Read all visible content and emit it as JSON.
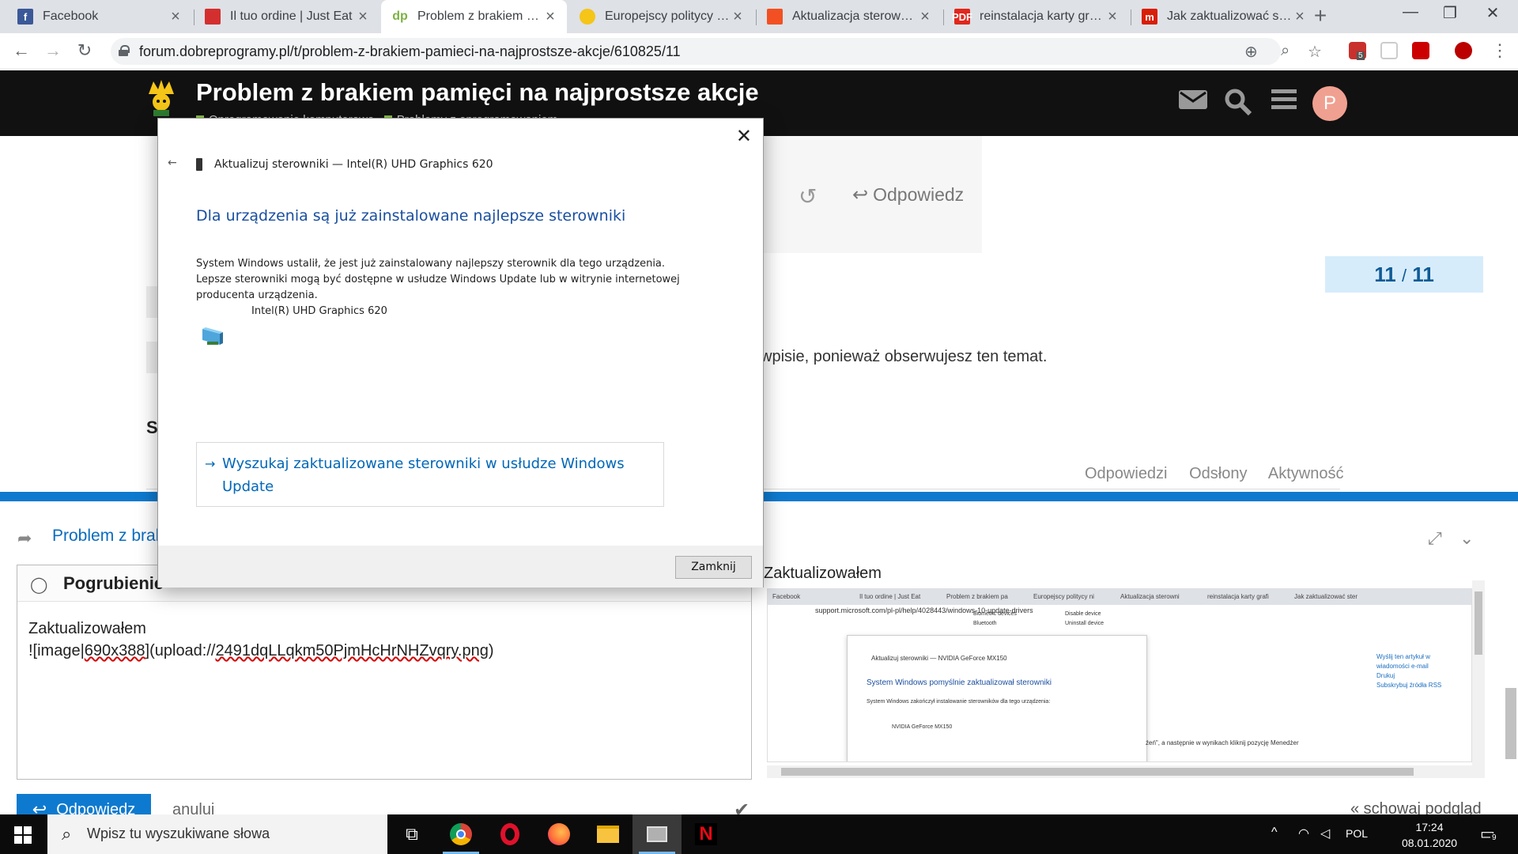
{
  "browser": {
    "tabs": [
      {
        "title": "Facebook",
        "favicon_color": "#3b5998",
        "favicon_glyph": "f",
        "active": false
      },
      {
        "title": "Il tuo ordine | Just Eat",
        "favicon_color": "#d32f2f",
        "favicon_glyph": "",
        "active": false
      },
      {
        "title": "Problem z brakiem pamięci na najprostsze akcje",
        "favicon_color": "#ffffff",
        "favicon_glyph": "dp",
        "active": true
      },
      {
        "title": "Europejscy politycy nie",
        "favicon_color": "#f5c518",
        "favicon_glyph": "",
        "active": false
      },
      {
        "title": "Aktualizacja sterowników",
        "favicon_color": "#f25022",
        "favicon_glyph": "",
        "active": false
      },
      {
        "title": "reinstalacja karty graficznej",
        "favicon_color": "#e1261c",
        "favicon_glyph": "PDF",
        "active": false
      },
      {
        "title": "Jak zaktualizować sterowniki",
        "favicon_color": "#d81e05",
        "favicon_glyph": "m",
        "active": false
      }
    ],
    "new_tab_label": "+",
    "window_controls": {
      "minimize": "—",
      "maximize": "❐",
      "close": "✕"
    },
    "url": "forum.dobreprogramy.pl/t/problem-z-brakiem-pamieci-na-najprostsze-akcje/610825/11",
    "extension_badge": "5"
  },
  "forum": {
    "title": "Problem z brakiem pamięci na najprostsze akcje",
    "category": "Oprogramowanie komputerowe",
    "subcategory": "Problemy z oprogramowaniem",
    "avatar_letter": "P",
    "reply_label": "Odpowiedz",
    "timeline_current": "11",
    "timeline_sep": "/",
    "timeline_total": "11",
    "notify_text": "wpisie, ponieważ obserwujesz ten temat.",
    "s_letter": "S",
    "list_headers": [
      "Odpowiedzi",
      "Odsłony",
      "Aktywność"
    ]
  },
  "composer": {
    "title": "Problem z brakiem pamięci na najprostsze akcje",
    "bold_label": "Pogrubienie",
    "text_line1": "Zaktualizowałem",
    "text_line2_a": "![image|",
    "text_line2_b": "690x388",
    "text_line2_c": "](upload://",
    "text_line2_d": "2491dqLLqkm50PjmHcHrNHZvqry.png",
    "text_line2_e": ")",
    "preview_title": "Zaktualizowałem",
    "reply_button": "Odpowiedz",
    "cancel": "anuluj",
    "hide_preview": "« schowaj podgląd"
  },
  "preview_image": {
    "tabs": [
      "Facebook",
      "Il tuo ordine | Just Eat",
      "Problem z brakiem pa",
      "Europejscy politycy ni",
      "Aktualizacja sterowni",
      "reinstalacja karty grafi",
      "Jak zaktualizować ster"
    ],
    "url": "support.microsoft.com/pl-pl/help/4028443/windows-10-update-drivers",
    "list_a": "Biometric devices",
    "list_b": "Bluetooth",
    "ctx_a": "Disable device",
    "ctx_b": "Uninstall device",
    "dlg_header": "Aktualizuj sterowniki — NVIDIA GeForce MX150",
    "dlg_title": "System Windows pomyślnie zaktualizował sterowniki",
    "dlg_desc": "System Windows zakończył instalowanie sterowników dla tego urządzenia:",
    "dlg_device": "NVIDIA GeForce MX150",
    "side_1": "Wyślij ten artykuł w wiadomości e-mail",
    "side_2": "Drukuj",
    "side_3": "Subskrybuj źródła RSS",
    "tail": "źeń\", a następnie w wynikach kliknij pozycję Menedżer"
  },
  "dialog": {
    "close": "✕",
    "back": "←",
    "header": "Aktualizuj sterowniki — Intel(R) UHD Graphics 620",
    "title": "Dla urządzenia są już zainstalowane najlepsze sterowniki",
    "description": "System Windows ustalił, że jest już zainstalowany najlepszy sterownik dla tego urządzenia. Lepsze sterowniki mogą być dostępne w usłudze Windows Update lub w witrynie internetowej producenta urządzenia.",
    "device_name": "Intel(R) UHD Graphics 620",
    "link": "Wyszukaj zaktualizowane sterowniki w usłudze Windows Update",
    "close_button": "Zamknij"
  },
  "taskbar": {
    "search_placeholder": "Wpisz tu wyszukiwane słowa",
    "language": "POL",
    "time": "17:24",
    "date": "08.01.2020",
    "notification_count": "9"
  }
}
